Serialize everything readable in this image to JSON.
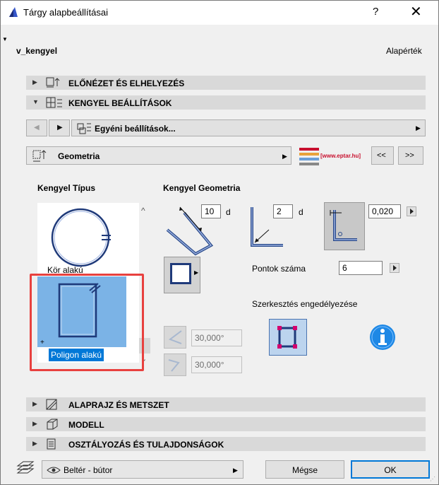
{
  "window": {
    "title": "Tárgy alapbeállításai",
    "help": "?",
    "close": "✕"
  },
  "object_name": "v_kengyel",
  "default_label": "Alapérték",
  "sections": {
    "preview": "ELŐNÉZET ÉS ELHELYEZÉS",
    "settings": "KENGYEL BEÁLLÍTÁSOK",
    "floorplan": "ALAPRAJZ ÉS METSZET",
    "model": "MODELL",
    "classification": "OSZTÁLYOZÁS ÉS TULAJDONSÁGOK"
  },
  "custom_settings": "Egyéni beállítások...",
  "geometry_page": "Geometria",
  "brand": "[www.eptar.hu]",
  "nav": {
    "prev": "<<",
    "next": ">>"
  },
  "type_title": "Kengyel Típus",
  "geometry_title": "Kengyel Geometria",
  "type_list": {
    "circle": "Kör alakú",
    "polygon": "Poligon alakú"
  },
  "geom": {
    "val1": "10",
    "unit1": "d",
    "val2": "2",
    "unit2": "d",
    "val3": "0,020"
  },
  "points_label": "Pontok száma",
  "points_value": "6",
  "edit_label": "Szerkesztés engedélyezése",
  "angle1": "30,000°",
  "angle2": "30,000°",
  "layer": "Beltér - bútor",
  "cancel": "Mégse",
  "ok": "OK",
  "colors": {
    "highlight": "#e8413f",
    "selection": "#7bb3e6",
    "brand_red": "#c8102e",
    "info_blue": "#1e88e5"
  }
}
